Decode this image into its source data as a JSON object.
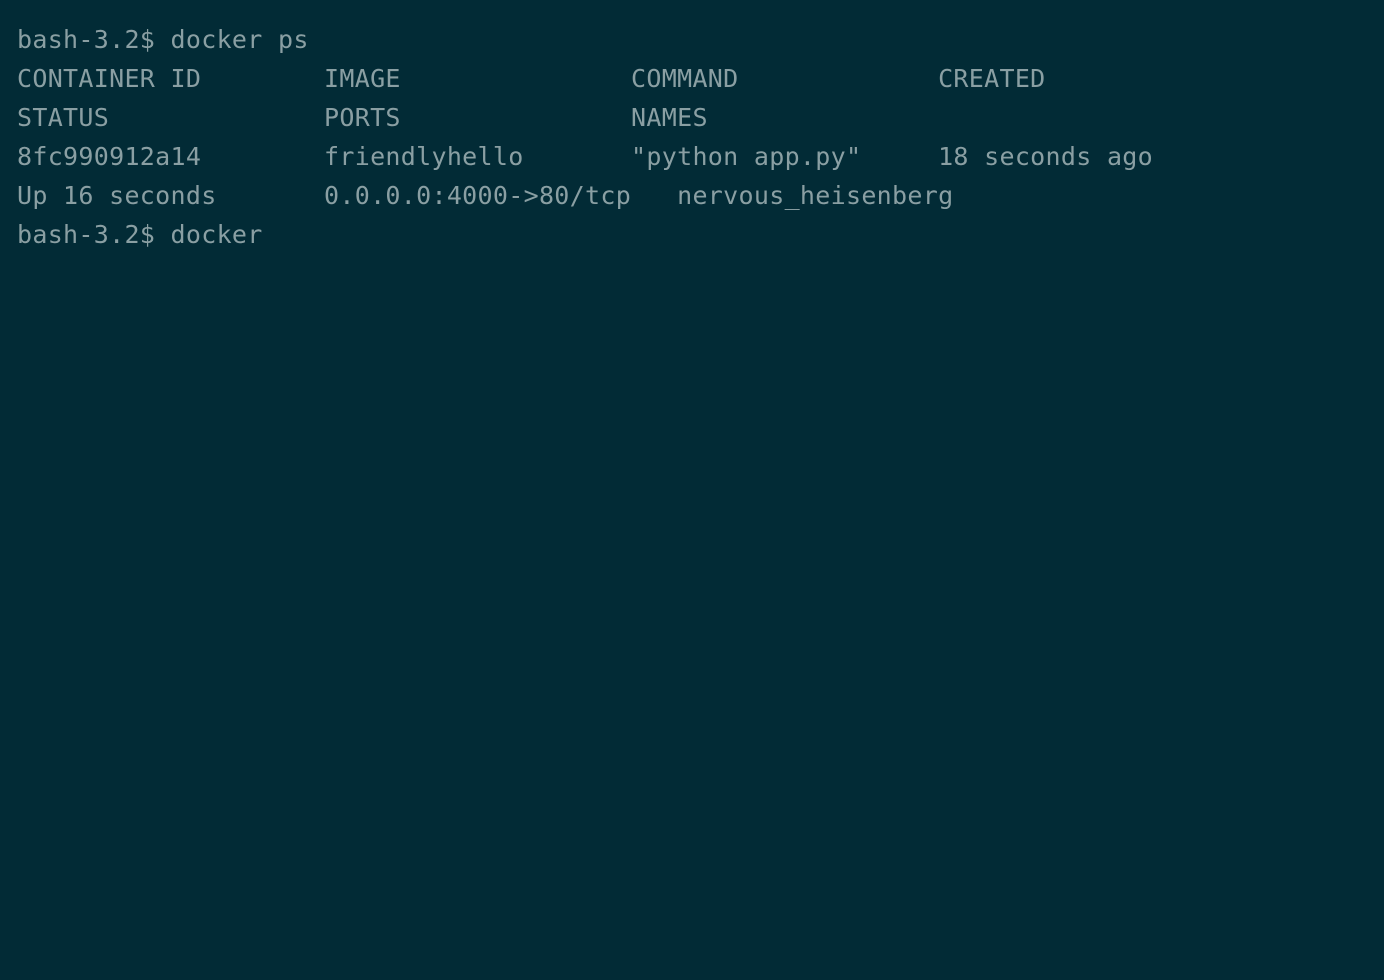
{
  "terminal": {
    "colors": {
      "background": "#022b36",
      "foreground": "#8a9fa3"
    },
    "prompt": "bash-3.2$",
    "lines": [
      {
        "id": "command-line",
        "type": "prompt",
        "text": "bash-3.2$ docker ps"
      },
      {
        "id": "header-line-1",
        "type": "header",
        "text": "CONTAINER ID        IMAGE               COMMAND             CREATED"
      },
      {
        "id": "header-line-2",
        "type": "header",
        "text": "STATUS              PORTS               NAMES"
      },
      {
        "id": "row-line-1",
        "type": "data",
        "text": "8fc990912a14        friendlyhello       \"python app.py\"     18 seconds ago"
      },
      {
        "id": "row-line-2",
        "type": "data",
        "text": "Up 16 seconds       0.0.0.0:4000->80/tcp   nervous_heisenberg"
      },
      {
        "id": "prompt-line-2",
        "type": "prompt",
        "text": "bash-3.2$ docker"
      }
    ],
    "command": {
      "executed": "docker ps",
      "pending": "docker"
    },
    "table": {
      "columns": [
        "CONTAINER ID",
        "IMAGE",
        "COMMAND",
        "CREATED",
        "STATUS",
        "PORTS",
        "NAMES"
      ],
      "rows": [
        {
          "container_id": "8fc990912a14",
          "image": "friendlyhello",
          "command": "\"python app.py\"",
          "created": "18 seconds ago",
          "status": "Up 16 seconds",
          "ports": "0.0.0.0:4000->80/tcp",
          "names": "nervous_heisenberg"
        }
      ]
    }
  }
}
